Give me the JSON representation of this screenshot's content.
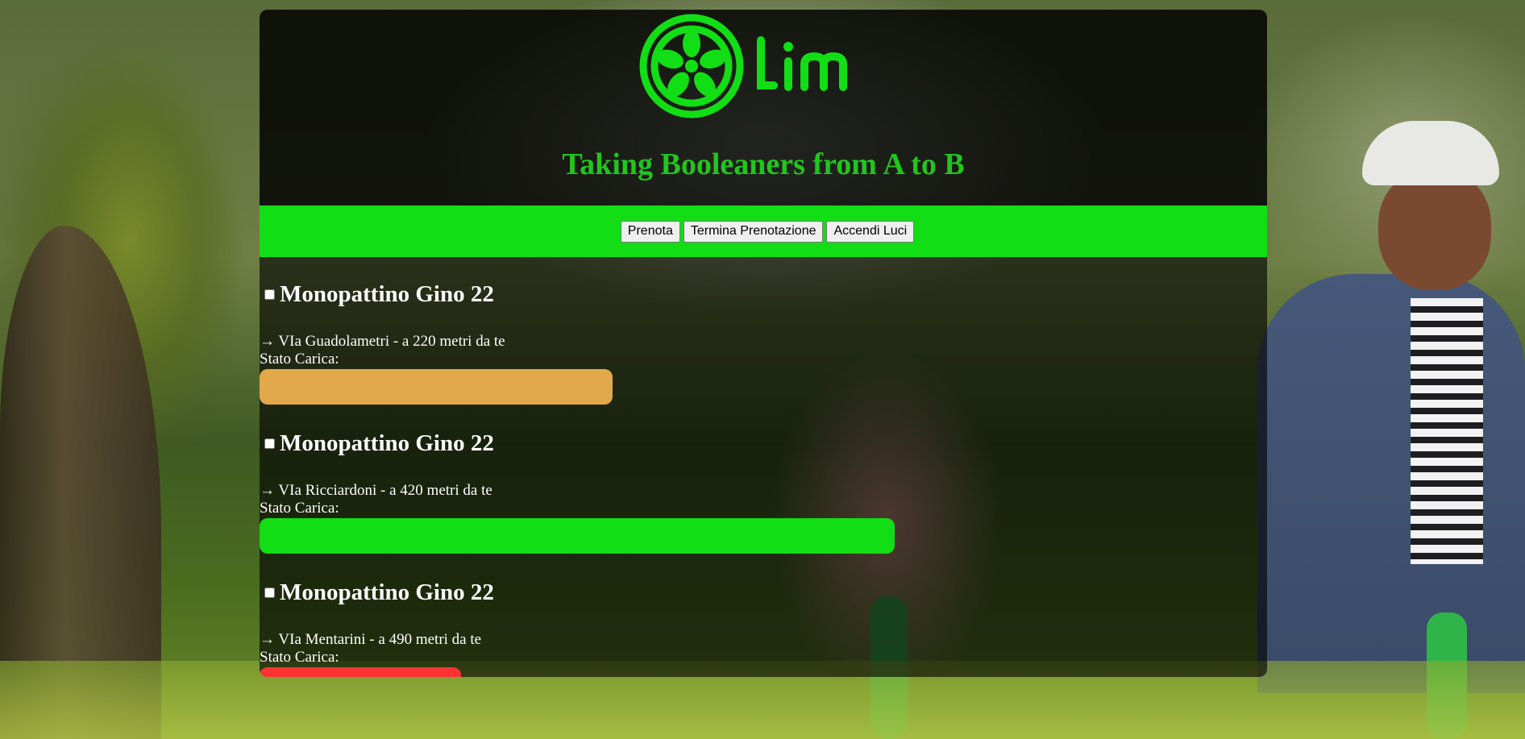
{
  "header": {
    "logo_text": "Lim",
    "logo_color": "#12de16",
    "tagline": "Taking Booleaners from A to B",
    "tagline_color": "#22c51e"
  },
  "toolbar": {
    "background": "#12de16",
    "prenota_label": "Prenota",
    "termina_label": "Termina Prenotazione",
    "luci_label": "Accendi Luci"
  },
  "scooters": [
    {
      "name": "Monopattino Gino 22",
      "checked": false,
      "location": "→ VIa Guadolametri - a 220 metri da te",
      "charge_label": "Stato Carica:",
      "charge_fraction": 0.35,
      "charge_color": "#e2a94a"
    },
    {
      "name": "Monopattino Gino 22",
      "checked": false,
      "location": "→ VIa Ricciardoni - a 420 metri da te",
      "charge_label": "Stato Carica:",
      "charge_fraction": 0.63,
      "charge_color": "#12de16"
    },
    {
      "name": "Monopattino Gino 22",
      "checked": false,
      "location": "→ VIa Mentarini - a 490 metri da te",
      "charge_label": "Stato Carica:",
      "charge_fraction": 0.2,
      "charge_color": "#ff3333"
    }
  ]
}
